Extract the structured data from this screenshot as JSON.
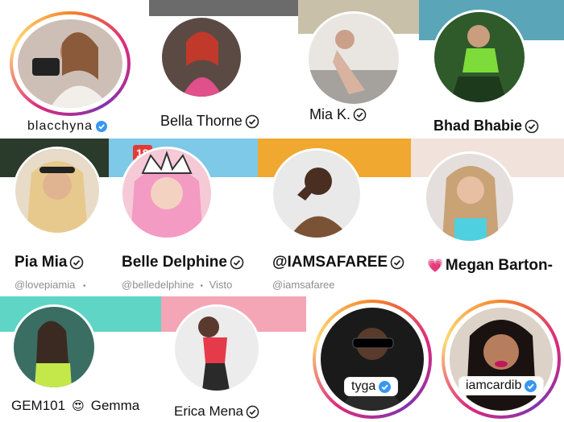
{
  "profiles": [
    {
      "username": "blacchyna",
      "verified": true
    },
    {
      "name": "Bella Thorne",
      "verified": true
    },
    {
      "name": "Mia K.",
      "verified": true
    },
    {
      "name": "Bhad Bhabie",
      "verified": true
    },
    {
      "name": "Pia Mia",
      "verified": true,
      "handle": "@lovepiamia",
      "sep": "•"
    },
    {
      "name": "Belle Delphine",
      "verified": true,
      "handle": "@belledelphine",
      "sep": "•",
      "status": "Visto",
      "badge": "18"
    },
    {
      "name": "@IAMSAFAREE",
      "verified": true,
      "handle": "@iamsafaree"
    },
    {
      "name": "Megan Barton-",
      "emoji": "💗"
    },
    {
      "name": "GEM101",
      "emoji": "😍",
      "name_suffix": "Gemma"
    },
    {
      "name": "Erica Mena",
      "verified": true
    },
    {
      "username": "tyga",
      "verified": true
    },
    {
      "username": "iamcardib",
      "verified": true
    }
  ],
  "colors": {
    "verified": "#3897f0",
    "ring_start": "#f58529",
    "ring_mid": "#dd2a7b",
    "ring_end": "#8134af"
  }
}
